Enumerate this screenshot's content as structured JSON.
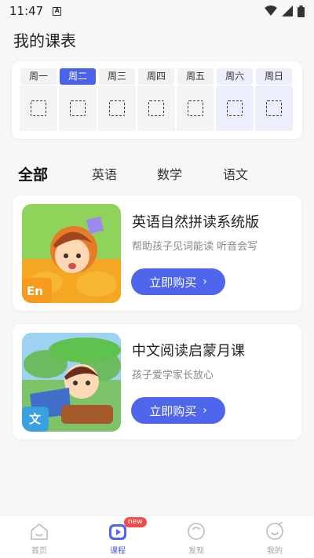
{
  "status_bar": {
    "time": "11:47",
    "indicator": "A"
  },
  "page_title": "我的课表",
  "schedule": {
    "days": [
      {
        "label": "周一",
        "selected": false,
        "weekend": false
      },
      {
        "label": "周二",
        "selected": true,
        "weekend": false
      },
      {
        "label": "周三",
        "selected": false,
        "weekend": false
      },
      {
        "label": "周四",
        "selected": false,
        "weekend": false
      },
      {
        "label": "周五",
        "selected": false,
        "weekend": false
      },
      {
        "label": "周六",
        "selected": false,
        "weekend": true
      },
      {
        "label": "周日",
        "selected": false,
        "weekend": true
      }
    ]
  },
  "tabs": [
    "全部",
    "英语",
    "数学",
    "语文"
  ],
  "courses": [
    {
      "title": "英语自然拼读系统版",
      "subtitle": "帮助孩子见词能读 听音会写",
      "button": "立即购买",
      "badge": "En"
    },
    {
      "title": "中文阅读启蒙月课",
      "subtitle": "孩子爱学家长放心",
      "button": "立即购买",
      "badge": "文"
    }
  ],
  "nav": {
    "items": [
      "首页",
      "课程",
      "发现",
      "我的"
    ],
    "active_index": 1,
    "new_badge": "new"
  },
  "colors": {
    "accent": "#4f66ec",
    "badge": "#f04c4c"
  }
}
